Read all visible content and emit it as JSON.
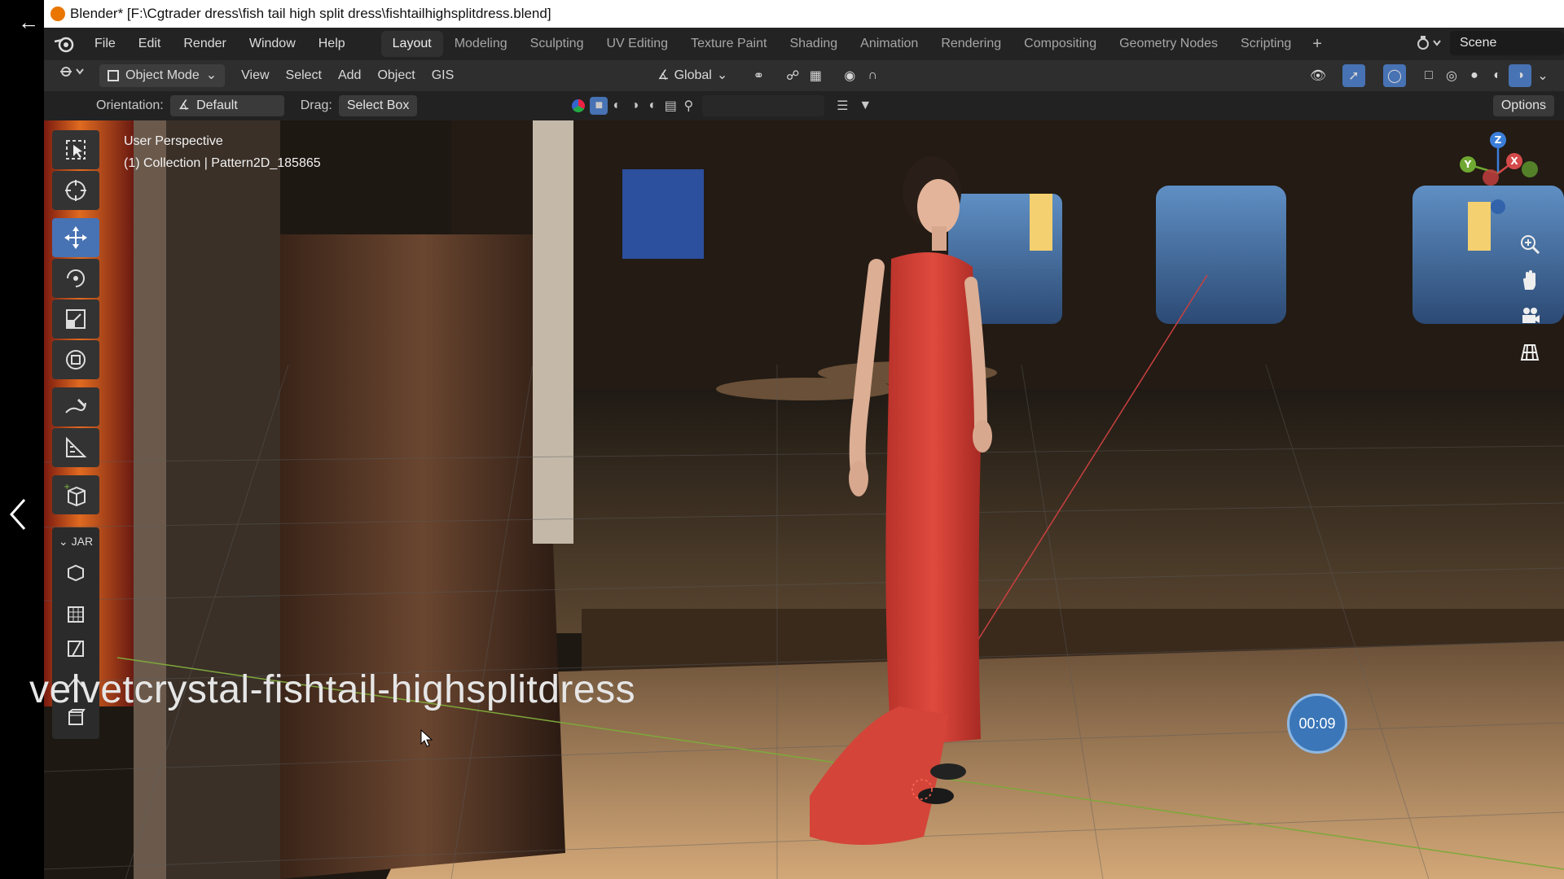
{
  "window": {
    "title": "Blender* [F:\\Cgtrader dress\\fish tail high split dress\\fishtailhighsplitdress.blend]"
  },
  "menu": {
    "items": [
      "File",
      "Edit",
      "Render",
      "Window",
      "Help"
    ]
  },
  "workspaces": {
    "tabs": [
      "Layout",
      "Modeling",
      "Sculpting",
      "UV Editing",
      "Texture Paint",
      "Shading",
      "Animation",
      "Rendering",
      "Compositing",
      "Geometry Nodes",
      "Scripting"
    ],
    "active": "Layout",
    "add_label": "+"
  },
  "scene": {
    "name": "Scene"
  },
  "header": {
    "mode": "Object Mode",
    "menus": [
      "View",
      "Select",
      "Add",
      "Object",
      "GIS"
    ],
    "transform_orientation": "Global"
  },
  "tool_settings": {
    "orientation_label": "Orientation:",
    "orientation_value": "Default",
    "drag_label": "Drag:",
    "drag_value": "Select Box",
    "options_label": "Options"
  },
  "viewport": {
    "perspective": "User Perspective",
    "collection": "(1) Collection | Pattern2D_185865",
    "caption": "velvetcrystal-fishtail-highsplitdress",
    "timer": "00:09",
    "jar_label": "JAR"
  },
  "gizmo": {
    "z": "Z",
    "y": "Y",
    "x": "X"
  },
  "colors": {
    "accent": "#4772b3",
    "dress": "#d8443a",
    "axis_x": "#d44a4a",
    "axis_y": "#6fa832",
    "axis_z": "#3b7ed9"
  }
}
